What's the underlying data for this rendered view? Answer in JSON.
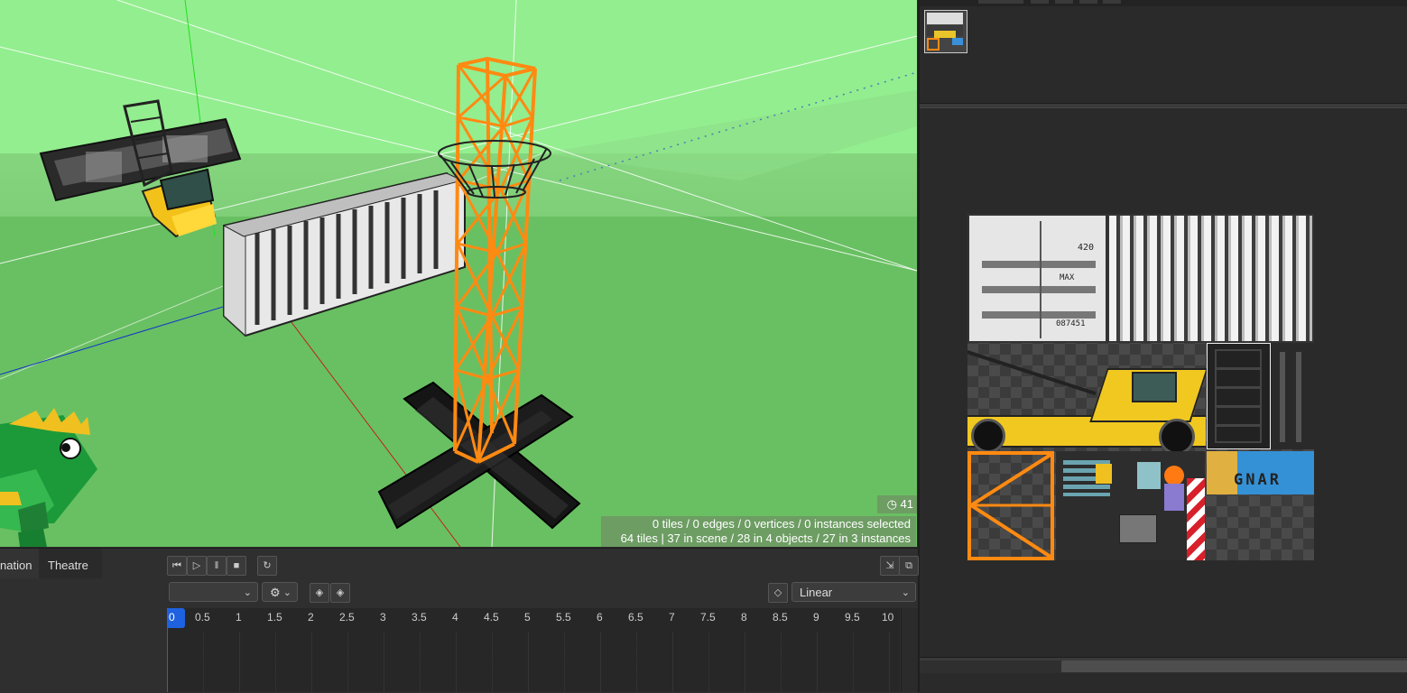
{
  "viewport": {
    "fps_counter": "41",
    "selection_status": "0 tiles / 0 edges / 0 vertices / 0 instances selected",
    "scene_status": "64 tiles | 37 in scene / 28 in 4 objects / 27 in 3 instances",
    "texture_label": "GNAR",
    "container_texts": [
      "420",
      "MAX",
      "087451"
    ]
  },
  "tabs": {
    "animation": "nation",
    "theatre": "Theatre"
  },
  "animation": {
    "transport": [
      "skip-to-start",
      "play",
      "pause",
      "stop"
    ],
    "interpolation": "Linear",
    "object_select": "",
    "ticks": [
      "0",
      "0.5",
      "1",
      "1.5",
      "2",
      "2.5",
      "3",
      "3.5",
      "4",
      "4.5",
      "5",
      "5.5",
      "6",
      "6.5",
      "7",
      "7.5",
      "8",
      "8.5",
      "9",
      "9.5",
      "10"
    ]
  },
  "colors": {
    "sky": "#93ee8f",
    "ground": "#69c062",
    "tower": "#ff8a12",
    "playhead": "#1e62e0",
    "panel": "#2b2b2b"
  }
}
